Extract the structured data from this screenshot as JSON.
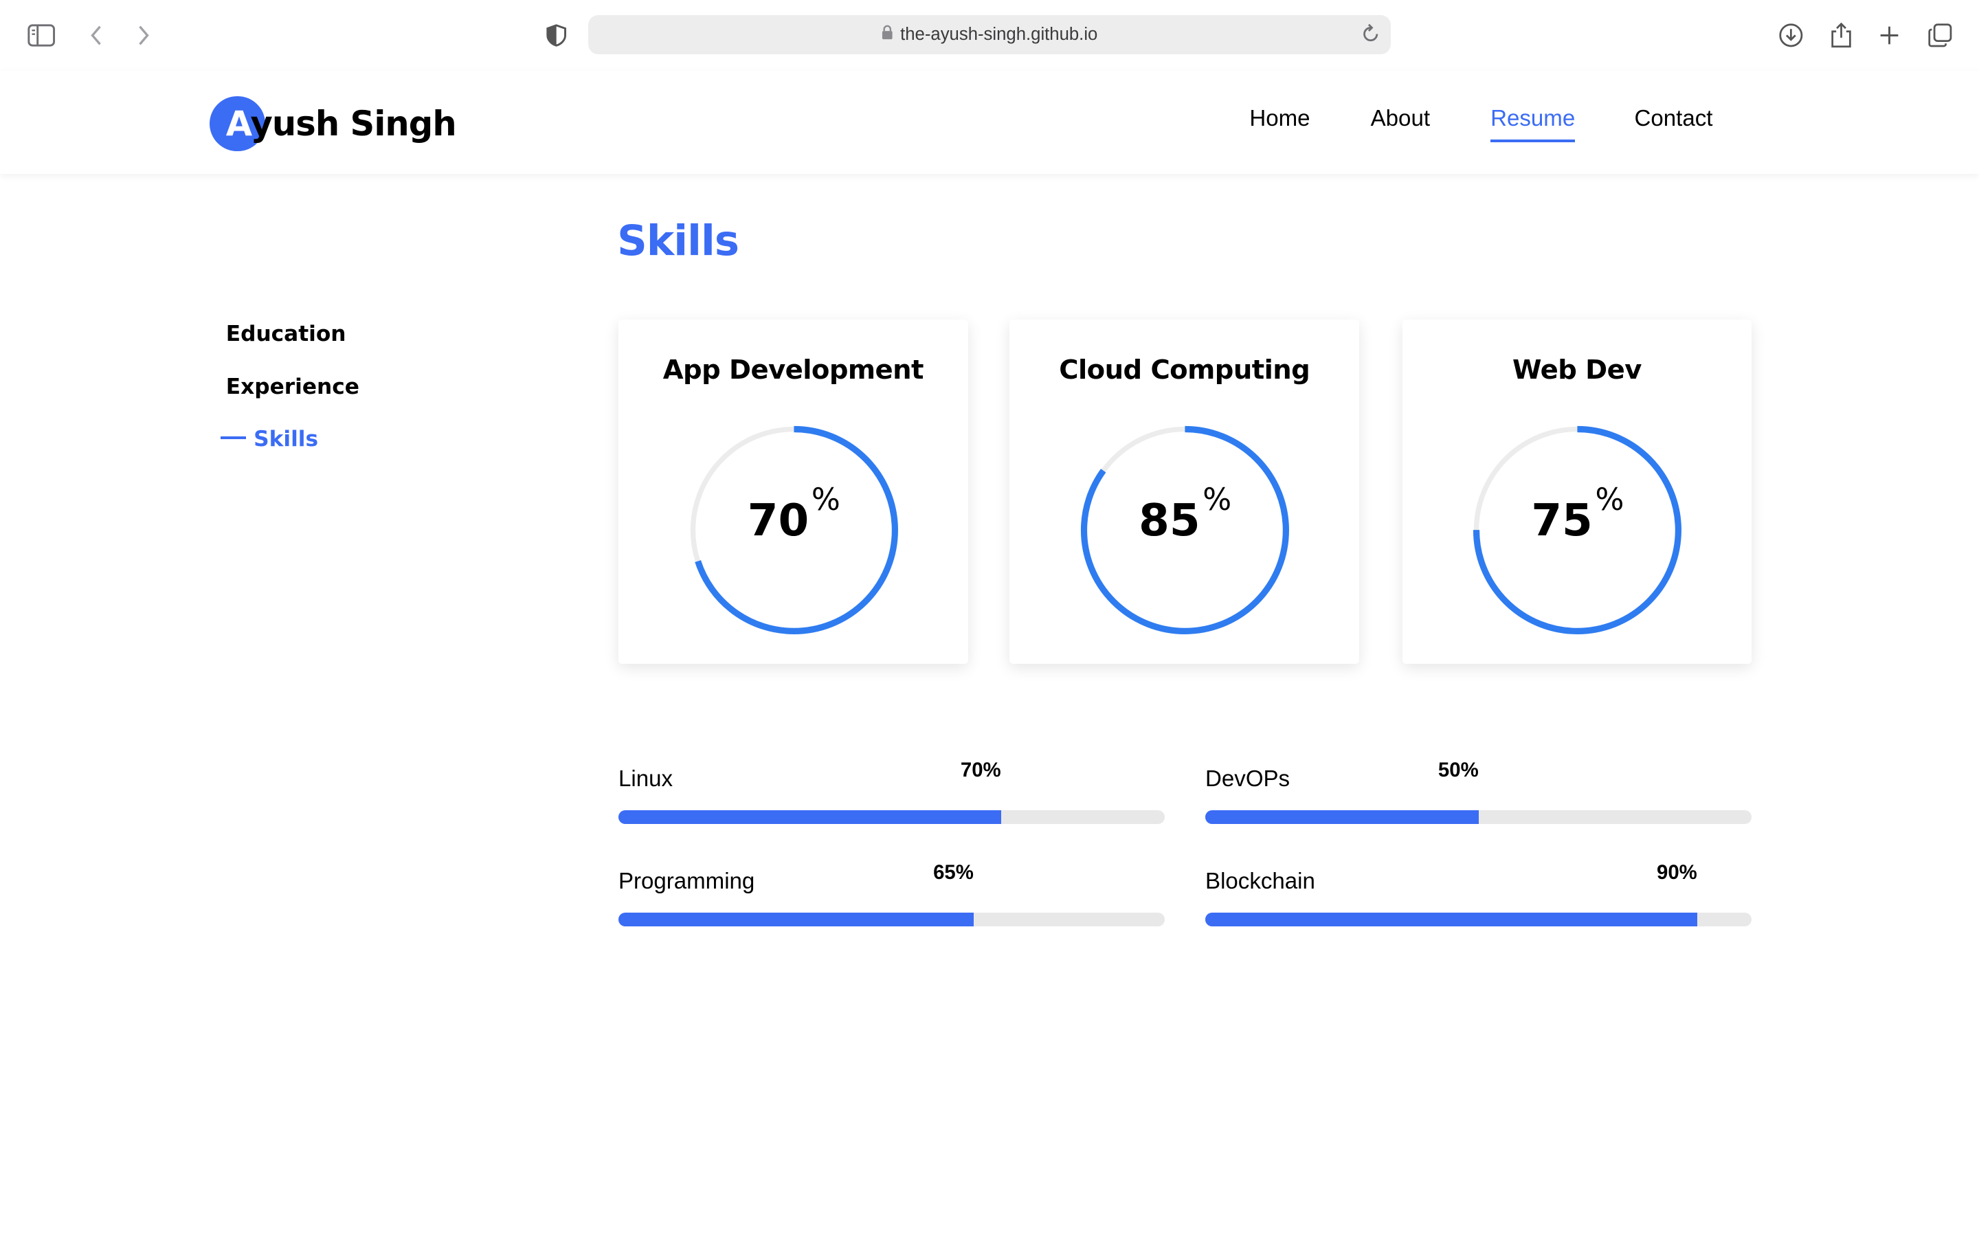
{
  "browser": {
    "url": "the-ayush-singh.github.io"
  },
  "header": {
    "logo_first_letter": "A",
    "logo_rest": "yush Singh",
    "nav": [
      {
        "label": "Home",
        "active": false
      },
      {
        "label": "About",
        "active": false
      },
      {
        "label": "Resume",
        "active": true
      },
      {
        "label": "Contact",
        "active": false
      }
    ]
  },
  "side_nav": [
    {
      "label": "Education",
      "active": false
    },
    {
      "label": "Experience",
      "active": false
    },
    {
      "label": "Skills",
      "active": true
    }
  ],
  "section_title": "Skills",
  "colors": {
    "accent": "#3b6cf4",
    "ring": "#2f7cf0",
    "track": "#ececec"
  },
  "skill_cards": [
    {
      "title": "App Development",
      "value": 70,
      "value_text": "70",
      "unit": "%"
    },
    {
      "title": "Cloud Computing",
      "value": 85,
      "value_text": "85",
      "unit": "%"
    },
    {
      "title": "Web Dev",
      "value": 75,
      "value_text": "75",
      "unit": "%"
    }
  ],
  "skill_bars": [
    {
      "label": "Linux",
      "value": 70,
      "value_text": "70%"
    },
    {
      "label": "DevOPs",
      "value": 50,
      "value_text": "50%"
    },
    {
      "label": "Programming",
      "value": 65,
      "value_text": "65%"
    },
    {
      "label": "Blockchain",
      "value": 90,
      "value_text": "90%"
    }
  ]
}
